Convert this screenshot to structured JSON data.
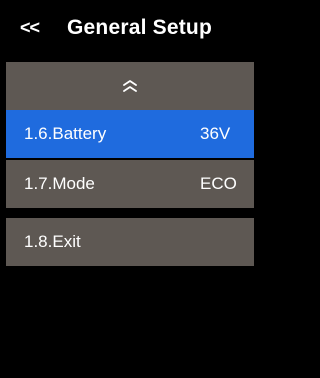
{
  "header": {
    "back_label": "<<",
    "title": "General Setup"
  },
  "menu": {
    "up_icon": "double-chevron-up-icon",
    "items": [
      {
        "label": "1.6.Battery",
        "value": "36V",
        "selected": true
      },
      {
        "label": "1.7.Mode",
        "value": "ECO",
        "selected": false
      },
      {
        "label": "1.8.Exit",
        "value": "",
        "selected": false
      }
    ]
  },
  "colors": {
    "background": "#000000",
    "row": "#5e5853",
    "selected_row": "#1f6bde",
    "text": "#ffffff"
  }
}
